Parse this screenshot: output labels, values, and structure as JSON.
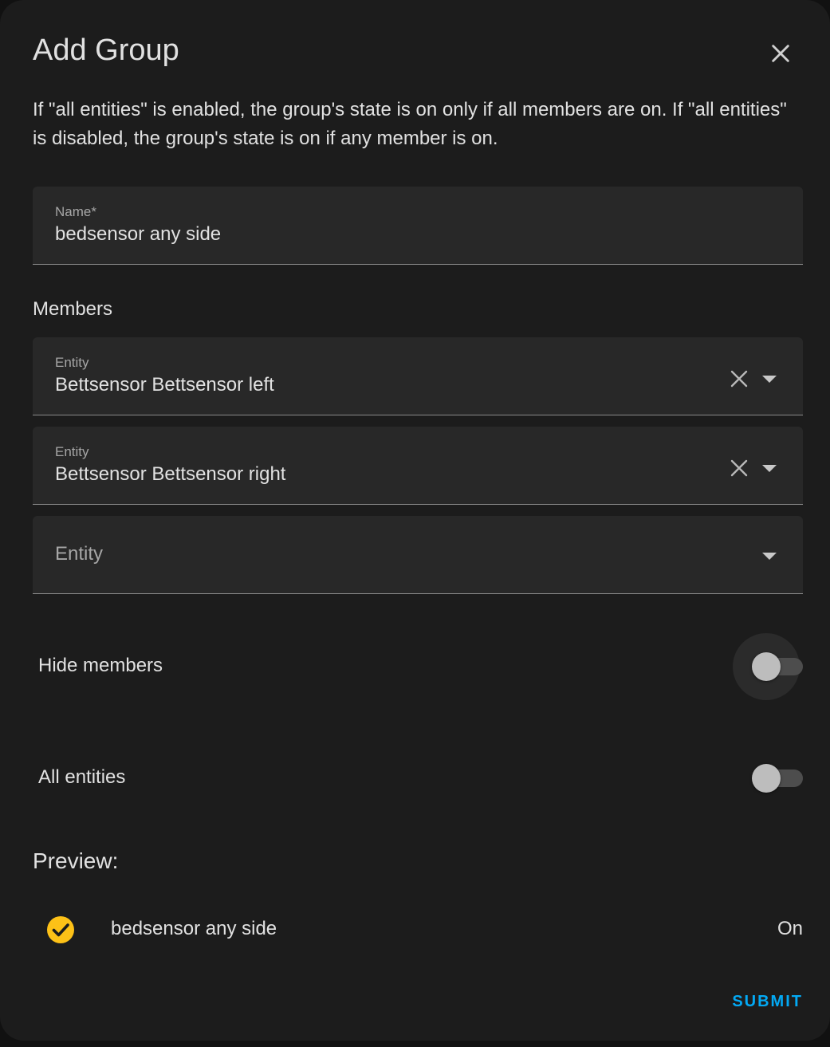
{
  "dialog": {
    "title": "Add Group",
    "description": "If \"all entities\" is enabled, the group's state is on only if all members are on. If \"all entities\" is disabled, the group's state is on if any member is on.",
    "close_icon": "close-icon"
  },
  "name_field": {
    "label": "Name*",
    "value": "bedsensor any side"
  },
  "members": {
    "label": "Members",
    "entities": [
      {
        "label": "Entity",
        "value": "Bettsensor Bettsensor left"
      },
      {
        "label": "Entity",
        "value": "Bettsensor Bettsensor right"
      },
      {
        "placeholder": "Entity",
        "value": ""
      }
    ]
  },
  "toggles": {
    "hide_members": {
      "label": "Hide members",
      "checked": false
    },
    "all_entities": {
      "label": "All entities",
      "checked": false
    }
  },
  "preview": {
    "label": "Preview:",
    "icon": "check-circle-icon",
    "icon_color": "#fdc117",
    "entity_name": "bedsensor any side",
    "state": "On"
  },
  "actions": {
    "submit_label": "SUBMIT",
    "submit_color": "#03a9f4"
  }
}
